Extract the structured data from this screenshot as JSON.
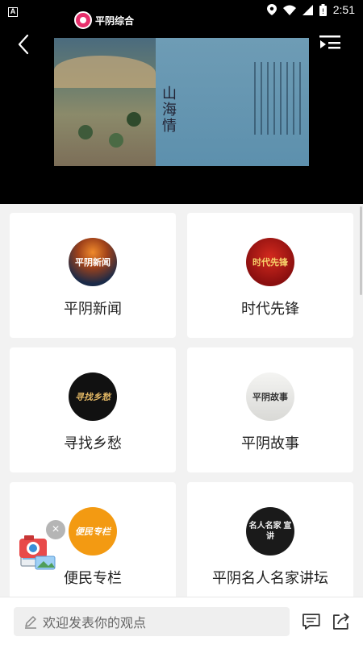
{
  "status_bar": {
    "left_indicator": "A",
    "time": "2:51",
    "icons": [
      "location-icon",
      "wifi-icon",
      "signal-icon",
      "battery-icon"
    ]
  },
  "header": {
    "logo_text": "平阴综合",
    "back_icon": "back-arrow-icon",
    "playlist_icon": "playlist-icon"
  },
  "video": {
    "title_text": "山海情"
  },
  "cards": [
    {
      "label": "平阴新闻",
      "thumb_text": "平阴新闻"
    },
    {
      "label": "时代先锋",
      "thumb_text": "时代先锋"
    },
    {
      "label": "寻找乡愁",
      "thumb_text": "寻找乡愁"
    },
    {
      "label": "平阴故事",
      "thumb_text": "平阴故事"
    },
    {
      "label": "便民专栏",
      "thumb_text": "便民专栏"
    },
    {
      "label": "平阴名人名家讲坛",
      "thumb_text": "名人名家 宣讲"
    }
  ],
  "comment_bar": {
    "placeholder": "欢迎发表你的观点",
    "icons": [
      "comment-icon",
      "share-icon"
    ]
  },
  "floating": {
    "close_symbol": "×"
  },
  "colors": {
    "header_bg": "#000000",
    "page_bg": "#f2f2f2",
    "logo_accent": "#e8306c",
    "service_orange": "#f39a12"
  }
}
